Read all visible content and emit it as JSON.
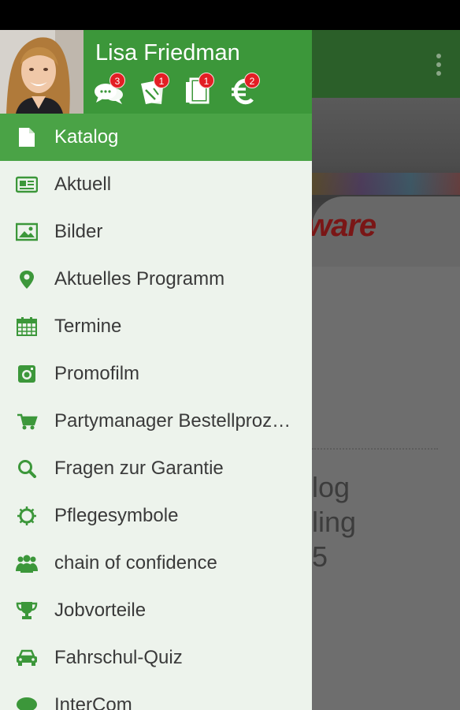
{
  "user": {
    "name": "Lisa Friedman",
    "badges": [
      {
        "icon": "chat-bubbles-icon",
        "count": "3"
      },
      {
        "icon": "voucher-tickets-icon",
        "count": "1"
      },
      {
        "icon": "documents-icon",
        "count": "1"
      },
      {
        "icon": "euro-icon",
        "count": "2"
      }
    ]
  },
  "menu": {
    "items": [
      {
        "icon": "document-icon",
        "label": "Katalog",
        "active": true
      },
      {
        "icon": "newspaper-icon",
        "label": "Aktuell"
      },
      {
        "icon": "image-icon",
        "label": "Bilder"
      },
      {
        "icon": "map-pin-icon",
        "label": "Aktuelles Programm"
      },
      {
        "icon": "calendar-icon",
        "label": "Termine"
      },
      {
        "icon": "camera-icon",
        "label": "Promofilm"
      },
      {
        "icon": "cart-icon",
        "label": "Partymanager Bestellprozess"
      },
      {
        "icon": "search-icon",
        "label": "Fragen zur Garantie"
      },
      {
        "icon": "sun-icon",
        "label": "Pflegesymbole"
      },
      {
        "icon": "group-icon",
        "label": "chain of confidence"
      },
      {
        "icon": "trophy-icon",
        "label": "Jobvorteile"
      },
      {
        "icon": "car-icon",
        "label": "Fahrschul-Quiz"
      },
      {
        "icon": "chat-icon",
        "label": "InterCom"
      }
    ]
  },
  "background": {
    "brand_fragment": "ware",
    "title_fragment": "log\nling\n5"
  },
  "colors": {
    "header": "#3c973a",
    "active_item": "#4aa346",
    "drawer_bg": "#edf3ec",
    "icon": "#3c973a",
    "badge": "#e31e24"
  }
}
